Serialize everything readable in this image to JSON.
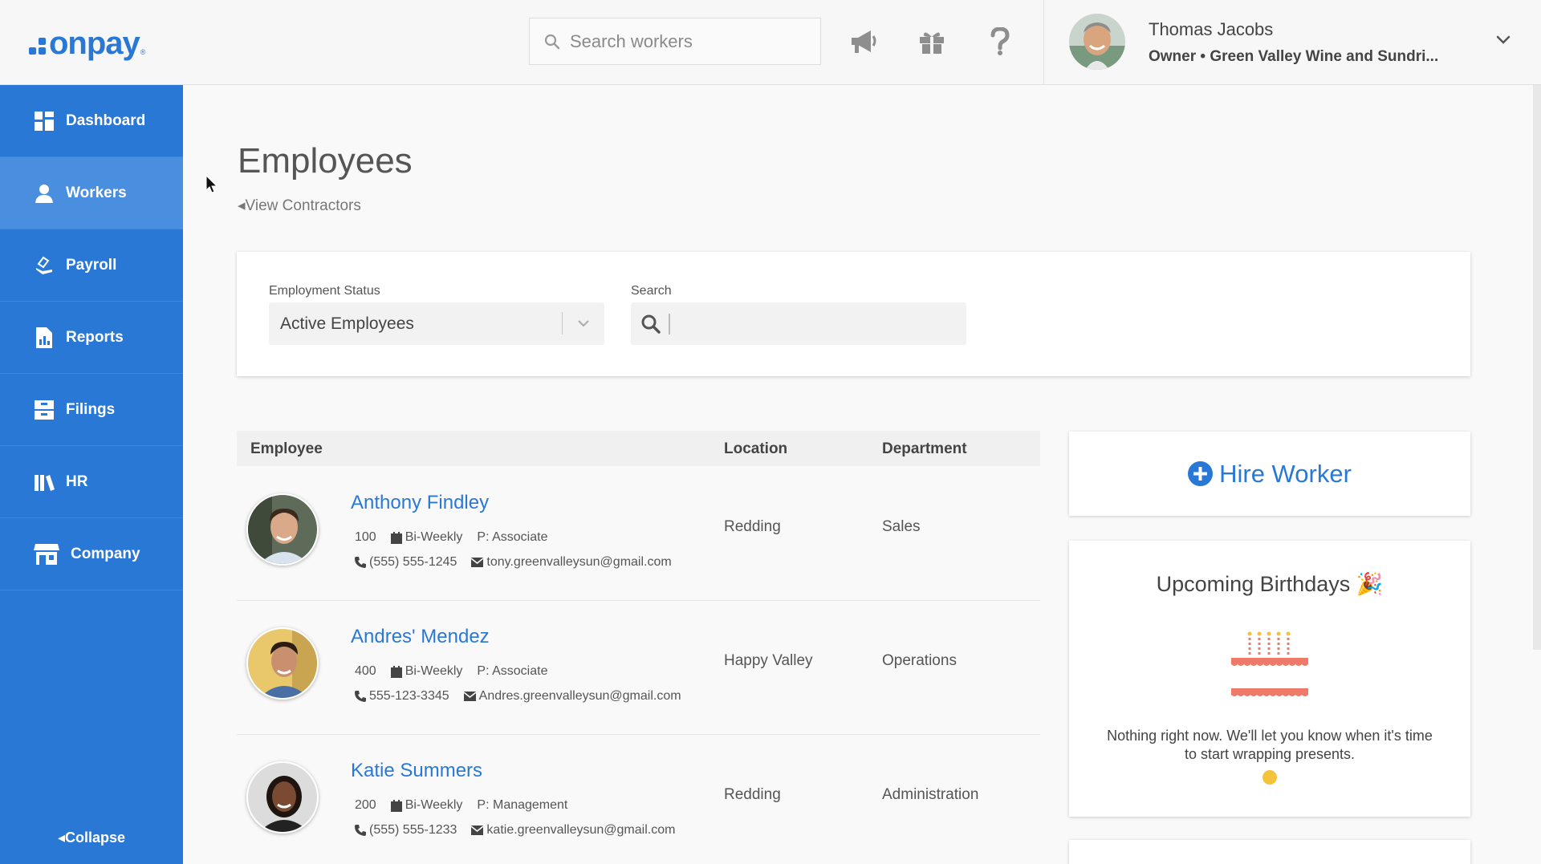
{
  "app": {
    "logo_text": "onpay",
    "logo_reg": "®"
  },
  "topbar": {
    "search_placeholder": "Search workers",
    "icons": [
      "megaphone-icon",
      "gift-icon",
      "help-icon"
    ],
    "user": {
      "name": "Thomas Jacobs",
      "role": "Owner • Green Valley Wine and Sundri..."
    }
  },
  "sidebar": {
    "items": [
      {
        "label": "Dashboard",
        "icon": "dashboard-icon",
        "active": false
      },
      {
        "label": "Workers",
        "icon": "workers-icon",
        "active": true
      },
      {
        "label": "Payroll",
        "icon": "payroll-icon",
        "active": false
      },
      {
        "label": "Reports",
        "icon": "reports-icon",
        "active": false
      },
      {
        "label": "Filings",
        "icon": "filings-icon",
        "active": false
      },
      {
        "label": "HR",
        "icon": "hr-icon",
        "active": false
      },
      {
        "label": "Company",
        "icon": "company-icon",
        "active": false
      }
    ],
    "collapse_label": "Collapse"
  },
  "page": {
    "title": "Employees",
    "view_contractors": "View Contractors"
  },
  "filters": {
    "status_label": "Employment Status",
    "status_value": "Active Employees",
    "search_label": "Search",
    "search_value": ""
  },
  "table": {
    "headers": {
      "employee": "Employee",
      "location": "Location",
      "department": "Department"
    },
    "rows": [
      {
        "name": "Anthony Findley",
        "id": "100",
        "frequency": "Bi-Weekly",
        "position": "P: Associate",
        "phone": "(555) 555-1245",
        "email": "tony.greenvalleysun@gmail.com",
        "location": "Redding",
        "department": "Sales"
      },
      {
        "name": "Andres' Mendez",
        "id": "400",
        "frequency": "Bi-Weekly",
        "position": "P: Associate",
        "phone": "555-123-3345",
        "email": "Andres.greenvalleysun@gmail.com",
        "location": "Happy Valley",
        "department": "Operations"
      },
      {
        "name": "Katie Summers",
        "id": "200",
        "frequency": "Bi-Weekly",
        "position": "P: Management",
        "phone": "(555) 555-1233",
        "email": "katie.greenvalleysun@gmail.com",
        "location": "Redding",
        "department": "Administration"
      }
    ]
  },
  "hire": {
    "label": "Hire Worker"
  },
  "birthdays": {
    "title": "Upcoming Birthdays 🎉",
    "message": "Nothing right now. We'll let you know when it's time to start wrapping presents."
  },
  "colors": {
    "brand": "#2a78d6",
    "sidebar_active": "#4a8ee0",
    "cake": "#f07a6a"
  }
}
